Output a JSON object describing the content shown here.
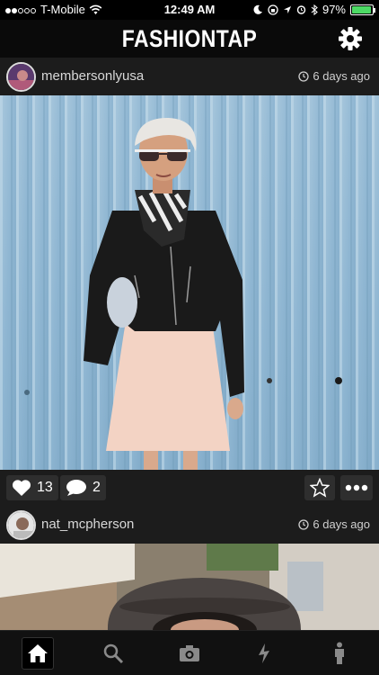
{
  "status_bar": {
    "carrier": "T-Mobile",
    "time": "12:49 AM",
    "battery": "97%",
    "battery_level": 0.97
  },
  "header": {
    "title": "FASHIONTAP"
  },
  "posts": [
    {
      "username": "membersonlyusa",
      "time_ago": "6 days ago",
      "likes": "13",
      "comments": "2"
    },
    {
      "username": "nat_mcpherson",
      "time_ago": "6 days ago"
    }
  ],
  "tabs": [
    {
      "icon": "home-icon",
      "active": true
    },
    {
      "icon": "search-icon",
      "active": false
    },
    {
      "icon": "camera-icon",
      "active": false
    },
    {
      "icon": "lightning-icon",
      "active": false
    },
    {
      "icon": "person-icon",
      "active": false
    }
  ],
  "colors": {
    "background": "#000000",
    "bar": "#1c1c1c",
    "battery": "#4cd964"
  }
}
